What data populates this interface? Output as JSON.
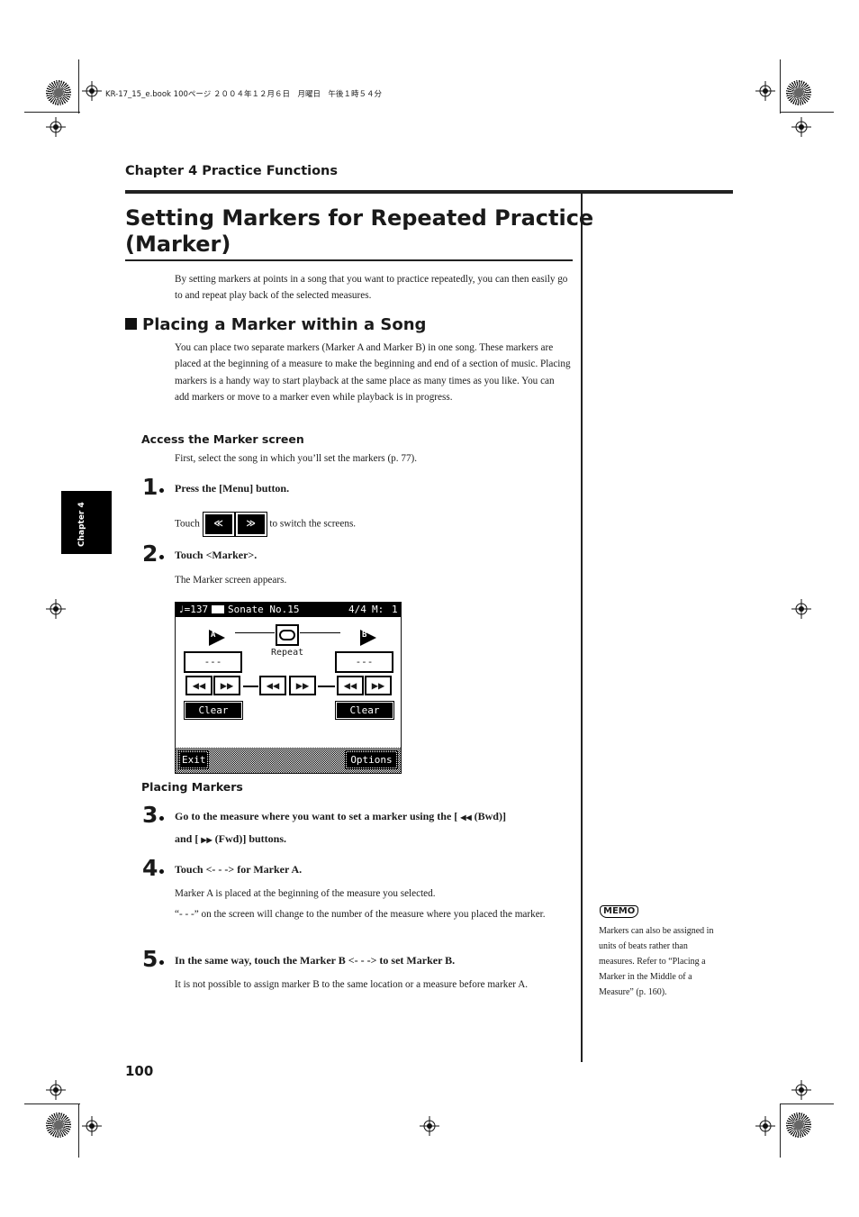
{
  "print_header": "KR-17_15_e.book  100ページ  ２００４年１２月６日　月曜日　午後１時５４分",
  "chapter_header": "Chapter 4 Practice Functions",
  "side_tab": "Chapter 4",
  "page_number": "100",
  "title_line1": "Setting Markers for Repeated Practice",
  "title_line2": "(Marker)",
  "intro": "By setting markers at points in a song that you want to practice repeatedly, you can then easily go to and repeat play back of the selected measures.",
  "section": {
    "heading": "Placing a Marker within a Song",
    "body": "You can place two separate markers (Marker A and Marker B) in one song. These markers are placed at the beginning of a measure to make the beginning and end of a section of music. Placing markers is a handy way to start playback at the same place as many times as you like. You can add markers or move to a marker even while playback is in progress."
  },
  "access": {
    "heading": "Access the Marker screen",
    "text": "First, select the song in which you’ll set the markers (p. 77)."
  },
  "steps": [
    {
      "num": "1",
      "text": "Press the [Menu] button.",
      "touch_prefix": "Touch",
      "touch_suffix": "to switch the screens.",
      "icon_left": "≪",
      "icon_right": "≫"
    },
    {
      "num": "2",
      "text": "Touch <Marker>.",
      "sub": "The Marker screen appears."
    },
    {
      "num": "3",
      "text_a": "Go to the measure where you want to set a marker using the [",
      "bwd_icon": "◀◀",
      "text_b": "(Bwd)]",
      "text_c": "and [",
      "fwd_icon": "▶▶",
      "text_d": "(Fwd)] buttons."
    },
    {
      "num": "4",
      "text": "Touch <- - -> for Marker A.",
      "sub1": "Marker A is placed at the beginning of the measure you selected.",
      "sub2": "“- - -” on the screen will change to the number of the measure where you placed the marker."
    },
    {
      "num": "5",
      "text": "In the same way, touch the Marker B <- - -> to set Marker B.",
      "sub": "It is not possible to assign marker B to the same location or a measure before marker A."
    }
  ],
  "placing_heading": "Placing Markers",
  "lcd": {
    "tempo": "♩=137",
    "song_icon": "book-icon",
    "song": "Sonate No.15",
    "time_sig": "4/4",
    "measure_label": "M:",
    "measure": "1",
    "marker_a_flag": "A",
    "marker_b_flag": "B",
    "marker_a_value": "---",
    "marker_b_value": "---",
    "repeat_label": "Repeat",
    "bwd": "◀◀",
    "fwd": "▶▶",
    "clear": "Clear",
    "exit": "Exit",
    "options": "Options"
  },
  "memo": {
    "label": "MEMO",
    "text": "Markers can also be assigned in units of beats rather than measures. Refer to “Placing a Marker in the Middle of a Measure” (p. 160)."
  }
}
